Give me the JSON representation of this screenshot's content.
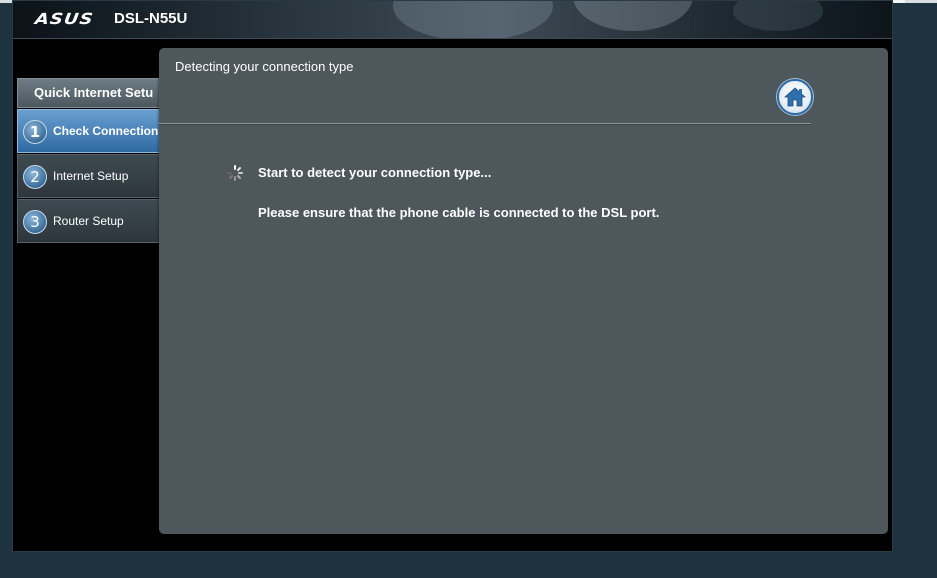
{
  "header": {
    "brand": "ASUS",
    "model": "DSL-N55U"
  },
  "sidebar": {
    "title": "Quick Internet Setu",
    "items": [
      {
        "number": "1",
        "label": "Check Connection",
        "active": true
      },
      {
        "number": "2",
        "label": "Internet Setup",
        "active": false
      },
      {
        "number": "3",
        "label": "Router Setup",
        "active": false
      }
    ]
  },
  "dialog": {
    "title": "Detecting your connection type",
    "home_icon": "home-icon",
    "status_message": "Start to detect your connection type...",
    "instruction": "Please ensure that the phone cable is connected to the DSL port.",
    "spinner_icon": "loading-spinner-icon"
  },
  "colors": {
    "dialog_bg": "#4d575c",
    "active_step": "#3f7db8",
    "page_bg": "#1e3240"
  }
}
